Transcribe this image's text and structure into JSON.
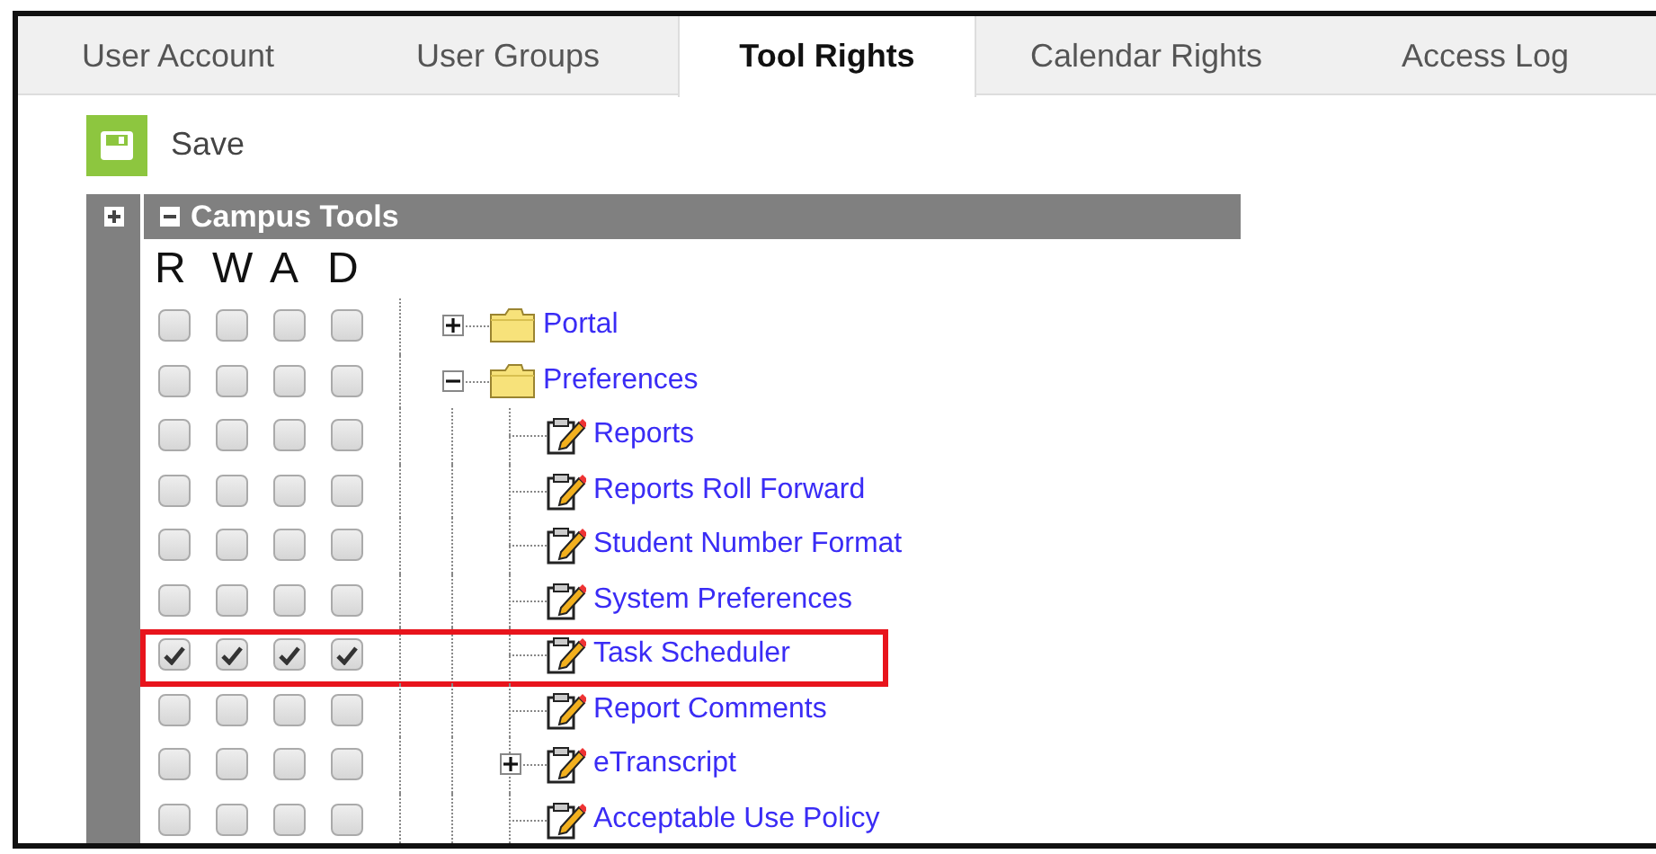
{
  "tabs": [
    {
      "label": "User Account",
      "selected": false
    },
    {
      "label": "User Groups",
      "selected": false
    },
    {
      "label": "Tool Rights",
      "selected": true
    },
    {
      "label": "Calendar Rights",
      "selected": false
    },
    {
      "label": "Access Log",
      "selected": false
    }
  ],
  "save_button": {
    "label": "Save"
  },
  "panel": {
    "title": "Campus Tools",
    "expanded": true,
    "columns": [
      "R",
      "W",
      "A",
      "D"
    ],
    "tree": [
      {
        "label": "Portal",
        "kind": "folder",
        "expanded": false,
        "highlighted": false,
        "rights": [
          {
            "checked": false
          },
          {
            "checked": false
          },
          {
            "checked": false
          },
          {
            "checked": false
          }
        ]
      },
      {
        "label": "Preferences",
        "kind": "folder",
        "expanded": true,
        "highlighted": false,
        "rights": [
          {
            "checked": false
          },
          {
            "checked": false
          },
          {
            "checked": false
          },
          {
            "checked": false
          }
        ],
        "children": [
          {
            "label": "Reports",
            "kind": "tool",
            "highlighted": false,
            "rights": [
              {
                "checked": false
              },
              {
                "checked": false
              },
              {
                "checked": false
              },
              {
                "checked": false
              }
            ]
          },
          {
            "label": "Reports Roll Forward",
            "kind": "tool",
            "highlighted": false,
            "rights": [
              {
                "checked": false
              },
              {
                "checked": false
              },
              {
                "checked": false
              },
              {
                "checked": false
              }
            ]
          },
          {
            "label": "Student Number Format",
            "kind": "tool",
            "highlighted": false,
            "rights": [
              {
                "checked": false
              },
              {
                "checked": false
              },
              {
                "checked": false
              },
              {
                "checked": false
              }
            ]
          },
          {
            "label": "System Preferences",
            "kind": "tool",
            "highlighted": false,
            "rights": [
              {
                "checked": false
              },
              {
                "checked": false
              },
              {
                "checked": false
              },
              {
                "checked": false
              }
            ]
          },
          {
            "label": "Task Scheduler",
            "kind": "tool",
            "highlighted": true,
            "rights": [
              {
                "checked": true
              },
              {
                "checked": true
              },
              {
                "checked": true
              },
              {
                "checked": true
              }
            ]
          },
          {
            "label": "Report Comments",
            "kind": "tool",
            "highlighted": false,
            "rights": [
              {
                "checked": false
              },
              {
                "checked": false
              },
              {
                "checked": false
              },
              {
                "checked": false
              }
            ]
          },
          {
            "label": "eTranscript",
            "kind": "tool",
            "expanded": false,
            "highlighted": false,
            "rights": [
              {
                "checked": false
              },
              {
                "checked": false
              },
              {
                "checked": false
              },
              {
                "checked": false
              }
            ]
          },
          {
            "label": "Acceptable Use Policy",
            "kind": "tool",
            "highlighted": false,
            "rights": [
              {
                "checked": false
              },
              {
                "checked": false
              },
              {
                "checked": false
              },
              {
                "checked": false
              }
            ]
          }
        ]
      }
    ]
  }
}
